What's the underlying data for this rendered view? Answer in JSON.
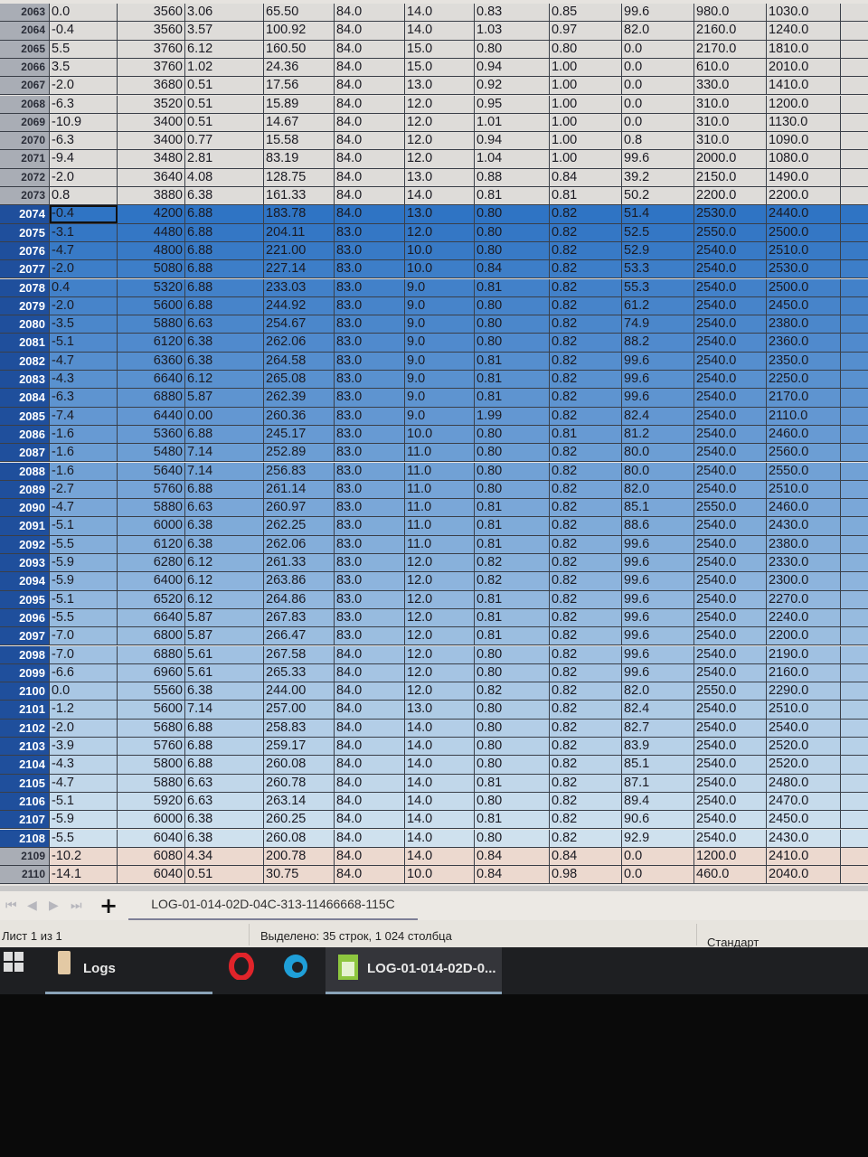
{
  "spreadsheet": {
    "cursor_row": "2074",
    "selected_rows": [
      "2074",
      "2108"
    ],
    "rows": [
      [
        "2063",
        "0.0",
        "3560",
        "3.06",
        "65.50",
        "84.0",
        "14.0",
        "0.83",
        "0.85",
        "99.6",
        "980.0",
        "1030.0"
      ],
      [
        "2064",
        "-0.4",
        "3560",
        "3.57",
        "100.92",
        "84.0",
        "14.0",
        "1.03",
        "0.97",
        "82.0",
        "2160.0",
        "1240.0"
      ],
      [
        "2065",
        "5.5",
        "3760",
        "6.12",
        "160.50",
        "84.0",
        "15.0",
        "0.80",
        "0.80",
        "0.0",
        "2170.0",
        "1810.0"
      ],
      [
        "2066",
        "3.5",
        "3760",
        "1.02",
        "24.36",
        "84.0",
        "15.0",
        "0.94",
        "1.00",
        "0.0",
        "610.0",
        "2010.0"
      ],
      [
        "2067",
        "-2.0",
        "3680",
        "0.51",
        "17.56",
        "84.0",
        "13.0",
        "0.92",
        "1.00",
        "0.0",
        "330.0",
        "1410.0"
      ],
      [
        "2068",
        "-6.3",
        "3520",
        "0.51",
        "15.89",
        "84.0",
        "12.0",
        "0.95",
        "1.00",
        "0.0",
        "310.0",
        "1200.0"
      ],
      [
        "2069",
        "-10.9",
        "3400",
        "0.51",
        "14.67",
        "84.0",
        "12.0",
        "1.01",
        "1.00",
        "0.0",
        "310.0",
        "1130.0"
      ],
      [
        "2070",
        "-6.3",
        "3400",
        "0.77",
        "15.58",
        "84.0",
        "12.0",
        "0.94",
        "1.00",
        "0.8",
        "310.0",
        "1090.0"
      ],
      [
        "2071",
        "-9.4",
        "3480",
        "2.81",
        "83.19",
        "84.0",
        "12.0",
        "1.04",
        "1.00",
        "99.6",
        "2000.0",
        "1080.0"
      ],
      [
        "2072",
        "-2.0",
        "3640",
        "4.08",
        "128.75",
        "84.0",
        "13.0",
        "0.88",
        "0.84",
        "39.2",
        "2150.0",
        "1490.0"
      ],
      [
        "2073",
        "0.8",
        "3880",
        "6.38",
        "161.33",
        "84.0",
        "14.0",
        "0.81",
        "0.81",
        "50.2",
        "2200.0",
        "2200.0"
      ],
      [
        "2074",
        "-0.4",
        "4200",
        "6.88",
        "183.78",
        "84.0",
        "13.0",
        "0.80",
        "0.82",
        "51.4",
        "2530.0",
        "2440.0"
      ],
      [
        "2075",
        "-3.1",
        "4480",
        "6.88",
        "204.11",
        "83.0",
        "12.0",
        "0.80",
        "0.82",
        "52.5",
        "2550.0",
        "2500.0"
      ],
      [
        "2076",
        "-4.7",
        "4800",
        "6.88",
        "221.00",
        "83.0",
        "10.0",
        "0.80",
        "0.82",
        "52.9",
        "2540.0",
        "2510.0"
      ],
      [
        "2077",
        "-2.0",
        "5080",
        "6.88",
        "227.14",
        "83.0",
        "10.0",
        "0.84",
        "0.82",
        "53.3",
        "2540.0",
        "2530.0"
      ],
      [
        "2078",
        "0.4",
        "5320",
        "6.88",
        "233.03",
        "83.0",
        "9.0",
        "0.81",
        "0.82",
        "55.3",
        "2540.0",
        "2500.0"
      ],
      [
        "2079",
        "-2.0",
        "5600",
        "6.88",
        "244.92",
        "83.0",
        "9.0",
        "0.80",
        "0.82",
        "61.2",
        "2540.0",
        "2450.0"
      ],
      [
        "2080",
        "-3.5",
        "5880",
        "6.63",
        "254.67",
        "83.0",
        "9.0",
        "0.80",
        "0.82",
        "74.9",
        "2540.0",
        "2380.0"
      ],
      [
        "2081",
        "-5.1",
        "6120",
        "6.38",
        "262.06",
        "83.0",
        "9.0",
        "0.80",
        "0.82",
        "88.2",
        "2540.0",
        "2360.0"
      ],
      [
        "2082",
        "-4.7",
        "6360",
        "6.38",
        "264.58",
        "83.0",
        "9.0",
        "0.81",
        "0.82",
        "99.6",
        "2540.0",
        "2350.0"
      ],
      [
        "2083",
        "-4.3",
        "6640",
        "6.12",
        "265.08",
        "83.0",
        "9.0",
        "0.81",
        "0.82",
        "99.6",
        "2540.0",
        "2250.0"
      ],
      [
        "2084",
        "-6.3",
        "6880",
        "5.87",
        "262.39",
        "83.0",
        "9.0",
        "0.81",
        "0.82",
        "99.6",
        "2540.0",
        "2170.0"
      ],
      [
        "2085",
        "-7.4",
        "6440",
        "0.00",
        "260.36",
        "83.0",
        "9.0",
        "1.99",
        "0.82",
        "82.4",
        "2540.0",
        "2110.0"
      ],
      [
        "2086",
        "-1.6",
        "5360",
        "6.88",
        "245.17",
        "83.0",
        "10.0",
        "0.80",
        "0.81",
        "81.2",
        "2540.0",
        "2460.0"
      ],
      [
        "2087",
        "-1.6",
        "5480",
        "7.14",
        "252.89",
        "83.0",
        "11.0",
        "0.80",
        "0.82",
        "80.0",
        "2540.0",
        "2560.0"
      ],
      [
        "2088",
        "-1.6",
        "5640",
        "7.14",
        "256.83",
        "83.0",
        "11.0",
        "0.80",
        "0.82",
        "80.0",
        "2540.0",
        "2550.0"
      ],
      [
        "2089",
        "-2.7",
        "5760",
        "6.88",
        "261.14",
        "83.0",
        "11.0",
        "0.80",
        "0.82",
        "82.0",
        "2540.0",
        "2510.0"
      ],
      [
        "2090",
        "-4.7",
        "5880",
        "6.63",
        "260.97",
        "83.0",
        "11.0",
        "0.81",
        "0.82",
        "85.1",
        "2550.0",
        "2460.0"
      ],
      [
        "2091",
        "-5.1",
        "6000",
        "6.38",
        "262.25",
        "83.0",
        "11.0",
        "0.81",
        "0.82",
        "88.6",
        "2540.0",
        "2430.0"
      ],
      [
        "2092",
        "-5.5",
        "6120",
        "6.38",
        "262.06",
        "83.0",
        "11.0",
        "0.81",
        "0.82",
        "99.6",
        "2540.0",
        "2380.0"
      ],
      [
        "2093",
        "-5.9",
        "6280",
        "6.12",
        "261.33",
        "83.0",
        "12.0",
        "0.82",
        "0.82",
        "99.6",
        "2540.0",
        "2330.0"
      ],
      [
        "2094",
        "-5.9",
        "6400",
        "6.12",
        "263.86",
        "83.0",
        "12.0",
        "0.82",
        "0.82",
        "99.6",
        "2540.0",
        "2300.0"
      ],
      [
        "2095",
        "-5.1",
        "6520",
        "6.12",
        "264.86",
        "83.0",
        "12.0",
        "0.81",
        "0.82",
        "99.6",
        "2540.0",
        "2270.0"
      ],
      [
        "2096",
        "-5.5",
        "6640",
        "5.87",
        "267.83",
        "83.0",
        "12.0",
        "0.81",
        "0.82",
        "99.6",
        "2540.0",
        "2240.0"
      ],
      [
        "2097",
        "-7.0",
        "6800",
        "5.87",
        "266.47",
        "83.0",
        "12.0",
        "0.81",
        "0.82",
        "99.6",
        "2540.0",
        "2200.0"
      ],
      [
        "2098",
        "-7.0",
        "6880",
        "5.61",
        "267.58",
        "84.0",
        "12.0",
        "0.80",
        "0.82",
        "99.6",
        "2540.0",
        "2190.0"
      ],
      [
        "2099",
        "-6.6",
        "6960",
        "5.61",
        "265.33",
        "84.0",
        "12.0",
        "0.80",
        "0.82",
        "99.6",
        "2540.0",
        "2160.0"
      ],
      [
        "2100",
        "0.0",
        "5560",
        "6.38",
        "244.00",
        "84.0",
        "12.0",
        "0.82",
        "0.82",
        "82.0",
        "2550.0",
        "2290.0"
      ],
      [
        "2101",
        "-1.2",
        "5600",
        "7.14",
        "257.00",
        "84.0",
        "13.0",
        "0.80",
        "0.82",
        "82.4",
        "2540.0",
        "2510.0"
      ],
      [
        "2102",
        "-2.0",
        "5680",
        "6.88",
        "258.83",
        "84.0",
        "14.0",
        "0.80",
        "0.82",
        "82.7",
        "2540.0",
        "2540.0"
      ],
      [
        "2103",
        "-3.9",
        "5760",
        "6.88",
        "259.17",
        "84.0",
        "14.0",
        "0.80",
        "0.82",
        "83.9",
        "2540.0",
        "2520.0"
      ],
      [
        "2104",
        "-4.3",
        "5800",
        "6.88",
        "260.08",
        "84.0",
        "14.0",
        "0.80",
        "0.82",
        "85.1",
        "2540.0",
        "2520.0"
      ],
      [
        "2105",
        "-4.7",
        "5880",
        "6.63",
        "260.78",
        "84.0",
        "14.0",
        "0.81",
        "0.82",
        "87.1",
        "2540.0",
        "2480.0"
      ],
      [
        "2106",
        "-5.1",
        "5920",
        "6.63",
        "263.14",
        "84.0",
        "14.0",
        "0.80",
        "0.82",
        "89.4",
        "2540.0",
        "2470.0"
      ],
      [
        "2107",
        "-5.9",
        "6000",
        "6.38",
        "260.25",
        "84.0",
        "14.0",
        "0.81",
        "0.82",
        "90.6",
        "2540.0",
        "2450.0"
      ],
      [
        "2108",
        "-5.5",
        "6040",
        "6.38",
        "260.08",
        "84.0",
        "14.0",
        "0.80",
        "0.82",
        "92.9",
        "2540.0",
        "2430.0"
      ],
      [
        "2109",
        "-10.2",
        "6080",
        "4.34",
        "200.78",
        "84.0",
        "14.0",
        "0.84",
        "0.84",
        "0.0",
        "1200.0",
        "2410.0"
      ],
      [
        "2110",
        "-14.1",
        "6040",
        "0.51",
        "30.75",
        "84.0",
        "10.0",
        "0.84",
        "0.98",
        "0.0",
        "460.0",
        "2040.0"
      ]
    ]
  },
  "sheet_tabs": {
    "add_label": "+",
    "active_sheet": "LOG-01-014-02D-04C-313-11466668-115C"
  },
  "status_bar": {
    "sheet_info": "Лист 1 из 1",
    "selection_info": "Выделено: 35 строк, 1 024 столбца",
    "page_style": "Стандарт"
  },
  "taskbar": {
    "start_icon": "windows-logo-icon",
    "folder_label": "Logs",
    "window_label": "LOG-01-014-02D-0..."
  },
  "colors": {
    "selection_dark": "#2f74c4",
    "selection_light": "#cfe1ee",
    "row_header_selected": "#1f4f9c"
  }
}
